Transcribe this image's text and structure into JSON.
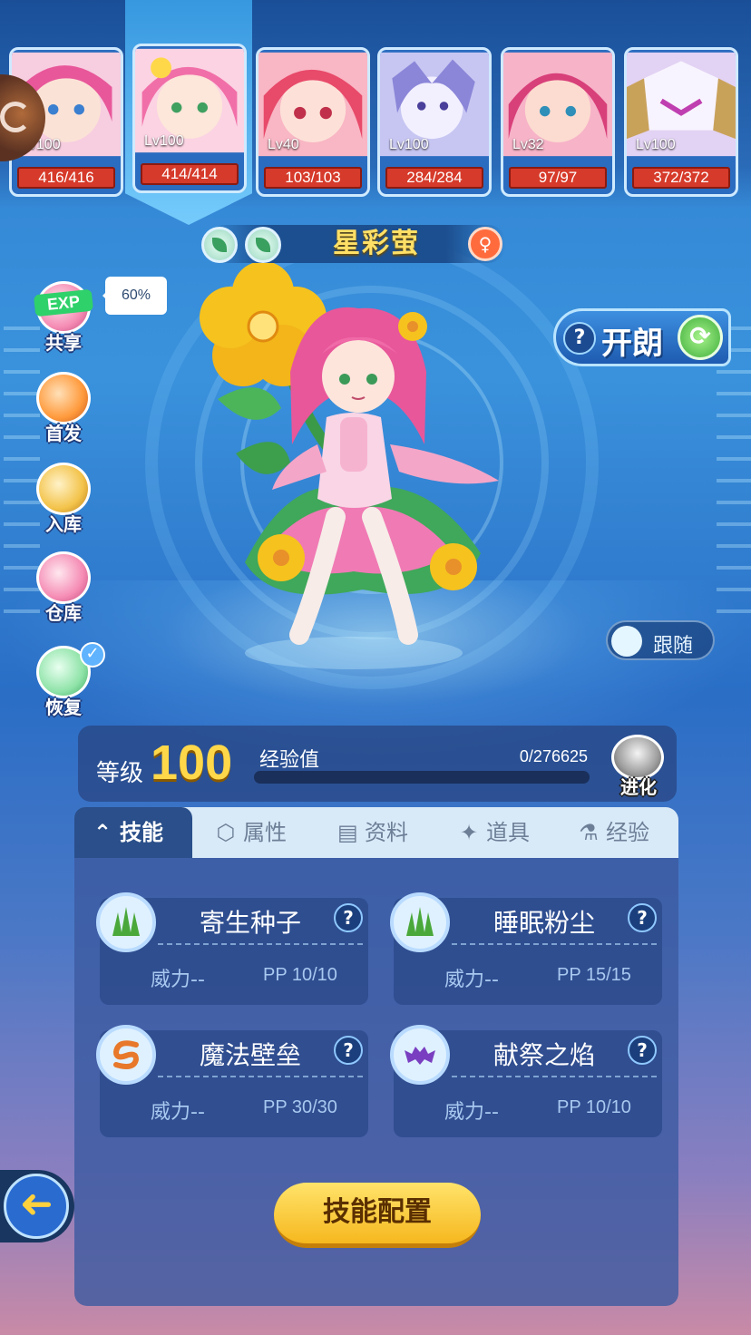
{
  "team": [
    {
      "level": "Lv100",
      "hp": "416/416",
      "color": "#f28fb8"
    },
    {
      "level": "Lv100",
      "hp": "414/414",
      "color": "#f4a6c6"
    },
    {
      "level": "Lv40",
      "hp": "103/103",
      "color": "#ef6f8a"
    },
    {
      "level": "Lv100",
      "hp": "284/284",
      "color": "#b7b0e8"
    },
    {
      "level": "Lv32",
      "hp": "97/97",
      "color": "#e05f86"
    },
    {
      "level": "Lv100",
      "hp": "372/372",
      "color": "#d9c3ef"
    }
  ],
  "pet": {
    "name": "星彩萤"
  },
  "side_menu": {
    "exp_badge": "EXP",
    "share_pct": "60%",
    "share": "共享",
    "first": "首发",
    "store": "入库",
    "warehouse": "仓库",
    "restore": "恢复"
  },
  "kailang": {
    "label": "开朗",
    "help": "?"
  },
  "follow": {
    "label": "跟随"
  },
  "level": {
    "label": "等级",
    "value": "100",
    "exp_label": "经验值",
    "exp_value": "0/276625",
    "exp_fraction": 0,
    "evolve": "进化"
  },
  "tabs": [
    {
      "label": "技能",
      "icon": "up-arrow-icon"
    },
    {
      "label": "属性",
      "icon": "hexagon-icon"
    },
    {
      "label": "资料",
      "icon": "clipboard-icon"
    },
    {
      "label": "道具",
      "icon": "item-icon"
    },
    {
      "label": "经验",
      "icon": "flask-icon"
    }
  ],
  "skills": [
    {
      "name": "寄生种子",
      "power": "威力--",
      "pp": "PP 10/10",
      "icon": "grass-icon"
    },
    {
      "name": "睡眠粉尘",
      "power": "威力--",
      "pp": "PP 15/15",
      "icon": "grass-icon"
    },
    {
      "name": "魔法壁垒",
      "power": "威力--",
      "pp": "PP 30/30",
      "icon": "swirl-icon"
    },
    {
      "name": "献祭之焰",
      "power": "威力--",
      "pp": "PP 10/10",
      "icon": "bat-icon"
    }
  ],
  "buttons": {
    "skill_config": "技能配置",
    "help": "?",
    "check": "✓"
  },
  "colors": {
    "accent_gold": "#ffd84a",
    "hp_red": "#d63a2a",
    "grass": "#4aa83a",
    "swirl": "#e8782a",
    "bat": "#7a3fc0"
  }
}
